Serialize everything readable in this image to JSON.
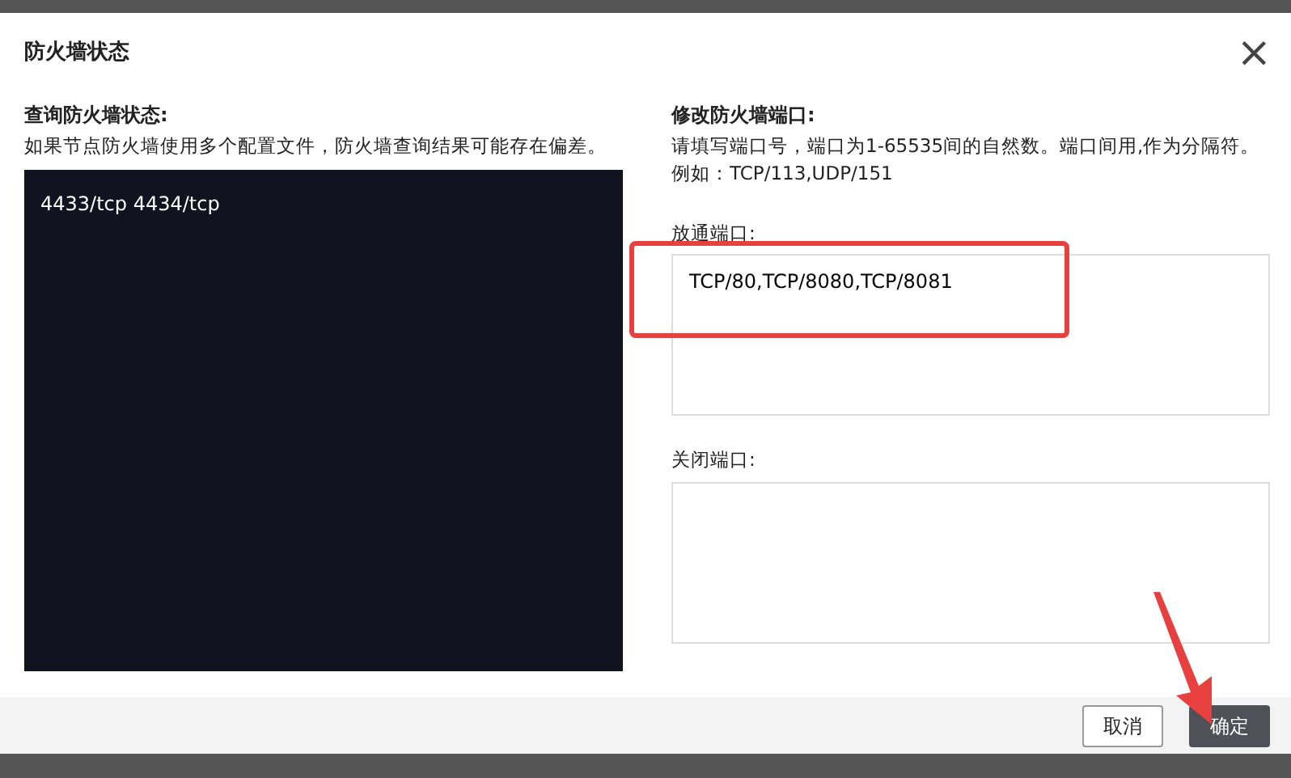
{
  "dialog": {
    "title": "防火墙状态",
    "close": "×"
  },
  "query": {
    "heading": "查询防火墙状态:",
    "note": "如果节点防火墙使用多个配置文件，防火墙查询结果可能存在偏差。",
    "output": "4433/tcp 4434/tcp"
  },
  "modify": {
    "heading": "修改防火墙端口:",
    "note": "请填写端口号，端口为1-65535间的自然数。端口间用,作为分隔符。例如：TCP/113,UDP/151",
    "fields": [
      {
        "label": "放通端口:",
        "value": "TCP/80,TCP/8080,TCP/8081",
        "highlighted": true
      },
      {
        "label": "关闭端口:",
        "highlighted": false
      }
    ]
  },
  "buttons": [
    {
      "label": "取消",
      "kind": "secondary"
    },
    {
      "label": "确定",
      "kind": "primary",
      "pointed": true
    }
  ]
}
